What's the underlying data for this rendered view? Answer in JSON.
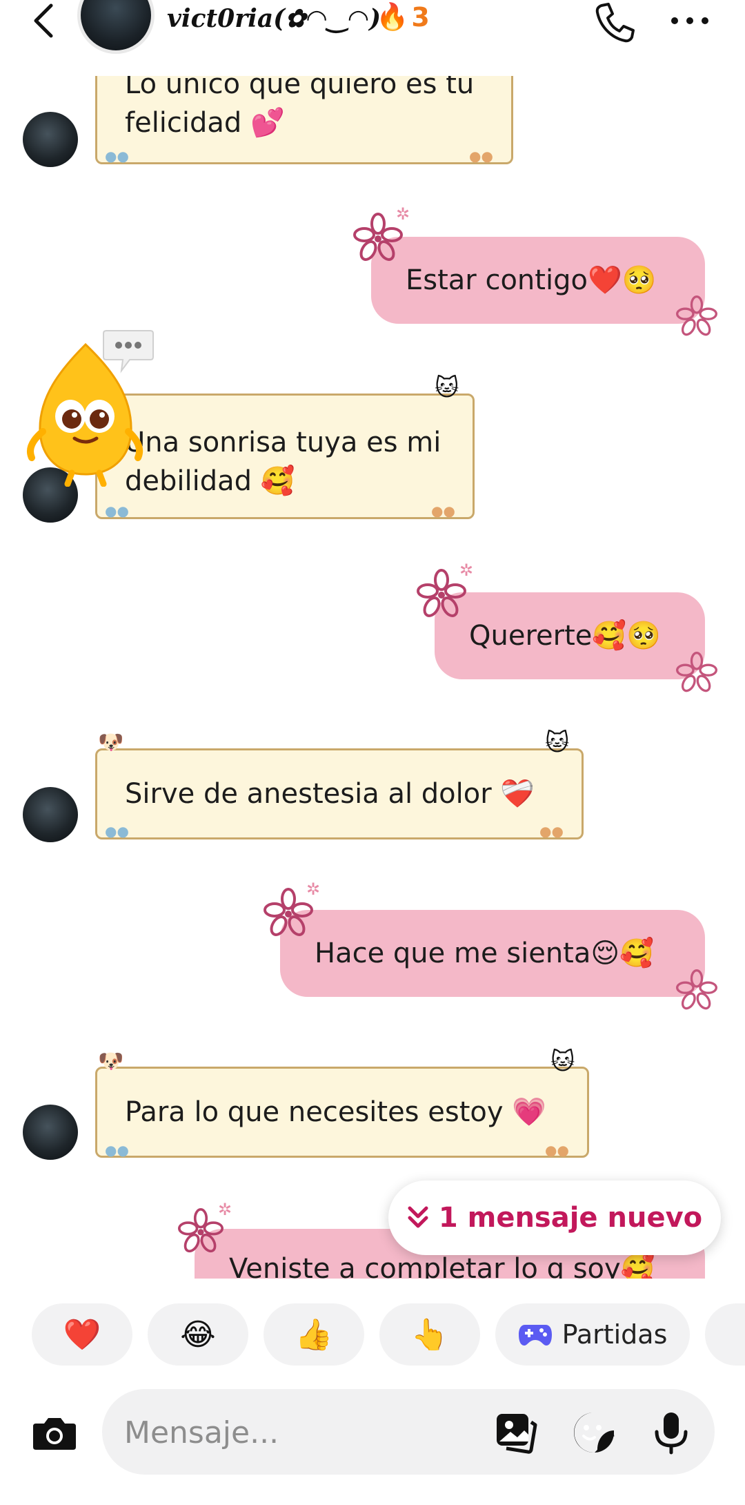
{
  "header": {
    "contact_name": "vict0ria(✿◠‿◠)",
    "streak_count": "3"
  },
  "messages": [
    {
      "dir": "in",
      "text_lines": [
        "Lo unico que quiero es tu",
        "felicidad 💕"
      ]
    },
    {
      "dir": "out",
      "text": "Estar contigo❤️🥺"
    },
    {
      "dir": "in",
      "text_lines": [
        "Una sonrisa tuya es mi",
        "debilidad 🥰"
      ]
    },
    {
      "dir": "out",
      "text": "Quererte🥰🥺"
    },
    {
      "dir": "in",
      "text_lines": [
        "Sirve de anestesia  al dolor ❤️‍🩹"
      ]
    },
    {
      "dir": "out",
      "text": "Hace que me sienta😌🥰"
    },
    {
      "dir": "in",
      "text_lines": [
        "Para lo que necesites estoy 💗"
      ]
    },
    {
      "dir": "out",
      "text": "Veniste a completar lo q soy🥰"
    }
  ],
  "new_message_pill": "1 mensaje nuevo",
  "quick_reactions": [
    "❤️",
    "😂",
    "👍",
    "👆"
  ],
  "games_label": "Partidas",
  "composer": {
    "placeholder": "Mensaje..."
  },
  "colors": {
    "accent": "#c2185b",
    "out_bubble": "#f4b8c8",
    "in_bubble": "#fdf6dc",
    "streak": "#f07a1a"
  }
}
